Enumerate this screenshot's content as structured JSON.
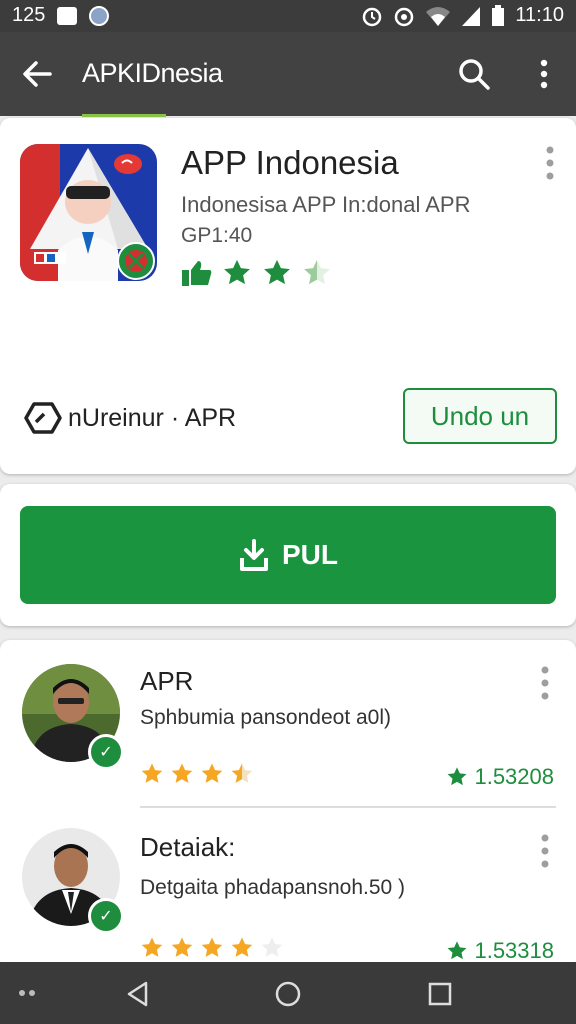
{
  "status_bar": {
    "time_left": "125",
    "time_right": "11:10"
  },
  "app_bar": {
    "title": "APKIDnesia"
  },
  "app_card": {
    "title": "APP Indonesia",
    "subtitle": "Indonesisa APP In:donal APR",
    "size": "GP1:40",
    "rating_stars": 2.5,
    "developer": "nUreinur · APR",
    "secondary_button": "Undo un"
  },
  "install_button": {
    "label": "PUL"
  },
  "reviews": [
    {
      "name": "APR",
      "text": "Sphbumia pansondeot a0l)",
      "stars": 3.5,
      "count": "1.53208"
    },
    {
      "name": "Detaiak:",
      "text": "Detgaita phadapansnoh.50 )",
      "stars": 4,
      "count": "1.53318"
    }
  ],
  "colors": {
    "accent_green": "#1b9440",
    "star_yellow": "#f5a623",
    "app_bar": "#424242"
  },
  "icons": [
    "back-arrow-icon",
    "search-icon",
    "more-vert-icon",
    "download-icon",
    "developer-icon",
    "back-nav-icon",
    "home-nav-icon",
    "recents-nav-icon"
  ]
}
